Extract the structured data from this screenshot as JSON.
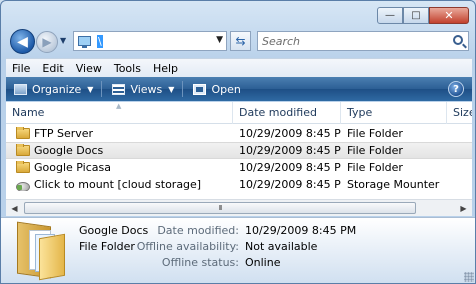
{
  "window": {
    "caption_buttons": {
      "minimize": "—",
      "maximize": "□",
      "close": "✕"
    }
  },
  "nav": {
    "back_glyph": "◀",
    "forward_glyph": "▶",
    "address_text": "\\",
    "search_placeholder": "Search"
  },
  "menu": [
    "File",
    "Edit",
    "View",
    "Tools",
    "Help"
  ],
  "toolbar": {
    "organize": "Organize",
    "views": "Views",
    "open": "Open",
    "help": "?"
  },
  "columns": {
    "name": "Name",
    "date": "Date modified",
    "type": "Type",
    "size": "Size"
  },
  "files": [
    {
      "name": "FTP Server",
      "date": "10/29/2009 8:45 PM",
      "type": "File Folder",
      "icon": "folder-icon"
    },
    {
      "name": "Google Docs",
      "date": "10/29/2009 8:45 PM",
      "type": "File Folder",
      "icon": "folder-icon",
      "selected": true
    },
    {
      "name": "Google Picasa",
      "date": "10/29/2009 8:45 PM",
      "type": "File Folder",
      "icon": "folder-icon"
    },
    {
      "name": "Click to mount [cloud storage]",
      "date": "10/29/2009 8:45 PM",
      "type": "Storage Mounter",
      "icon": "storage-mounter-icon"
    }
  ],
  "scrollbar": {
    "grip": "III"
  },
  "details": {
    "name": "Google Docs",
    "type": "File Folder",
    "date_label": "Date modified:",
    "date_value": "10/29/2009 8:45 PM",
    "offline_label": "Offline availability:",
    "offline_value": "Not available",
    "status_label": "Offline status:",
    "status_value": "Online"
  },
  "colors": {
    "toolbar": "#2c5f95",
    "selection": "#e4e4e4",
    "close_button": "#c2412d"
  }
}
